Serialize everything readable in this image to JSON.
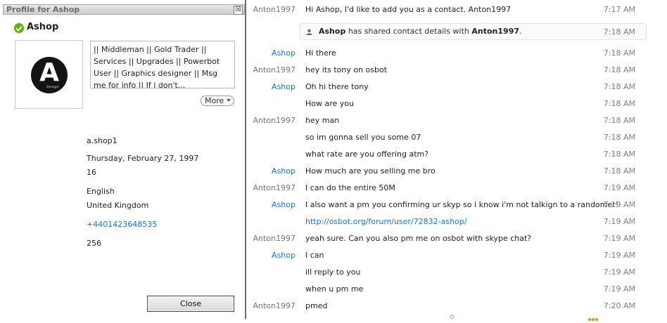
{
  "profile": {
    "window_title": "Profile for Ashop",
    "close_glyph": "☒",
    "name": "Ashop",
    "avatar_letter": "A",
    "avatar_sub": "Design",
    "mood": "|| Middleman || Gold Trader || Services || Upgrades || Powerbot User || Graphics designer || Msg me for info || If i don't...",
    "more_label": "More",
    "skype_name": "a.shop1",
    "birthday": "Thursday, February 27, 1997",
    "age": "16",
    "language": "English",
    "country": "United Kingdom",
    "phone": "+4401423648535",
    "contacts_count": "256",
    "close_label": "Close",
    "presence_color": "#59b300"
  },
  "chat": {
    "messages": [
      {
        "sender": "Anton1997",
        "text": "Hi Ashop, I'd like to add you as a contact. Anton1997",
        "time": "7:17 AM"
      },
      {
        "sender": "Ashop",
        "text": "Hi there",
        "time": "7:18 AM"
      },
      {
        "sender": "Anton1997",
        "text": "hey its tony on osbot",
        "time": "7:18 AM"
      },
      {
        "sender": "Ashop",
        "text": "Oh hi there tony",
        "time": "7:18 AM"
      },
      {
        "sender": "",
        "text": "How are you",
        "time": "7:18 AM"
      },
      {
        "sender": "Anton1997",
        "text": "hey man",
        "time": "7:18 AM"
      },
      {
        "sender": "",
        "text": "so im gonna sell you some 07",
        "time": "7:18 AM"
      },
      {
        "sender": "",
        "text": "what rate are you offering atm?",
        "time": "7:18 AM"
      },
      {
        "sender": "Ashop",
        "text": "How much are you selling me bro",
        "time": "7:18 AM"
      },
      {
        "sender": "Anton1997",
        "text": "I can do the entire 50M",
        "time": "7:19 AM"
      },
      {
        "sender": "Ashop",
        "text": "I also want a pm you confirming ur skyp so i know i'm not talkign to a randomer!",
        "time": "7:19 AM"
      },
      {
        "sender": "",
        "text": "http://osbot.org/forum/user/72832-ashop/",
        "time": "7:19 AM"
      },
      {
        "sender": "Anton1997",
        "text": "yeah sure. Can you also pm me on osbot with skype chat?",
        "time": "7:19 AM"
      },
      {
        "sender": "Ashop",
        "text": "I can",
        "time": "7:19 AM"
      },
      {
        "sender": "",
        "text": "ill reply to you",
        "time": "7:19 AM"
      },
      {
        "sender": "",
        "text": "when u pm me",
        "time": "7:19 AM"
      },
      {
        "sender": "Anton1997",
        "text": "pmed",
        "time": "7:20 AM"
      }
    ],
    "system_note": {
      "from": "Ashop",
      "middle": "has shared contact details with",
      "to": "Anton1997",
      "end": ".",
      "time": "7:18 AM"
    },
    "link_color": "#1b76c6",
    "typing_color": "#f08a1e"
  }
}
